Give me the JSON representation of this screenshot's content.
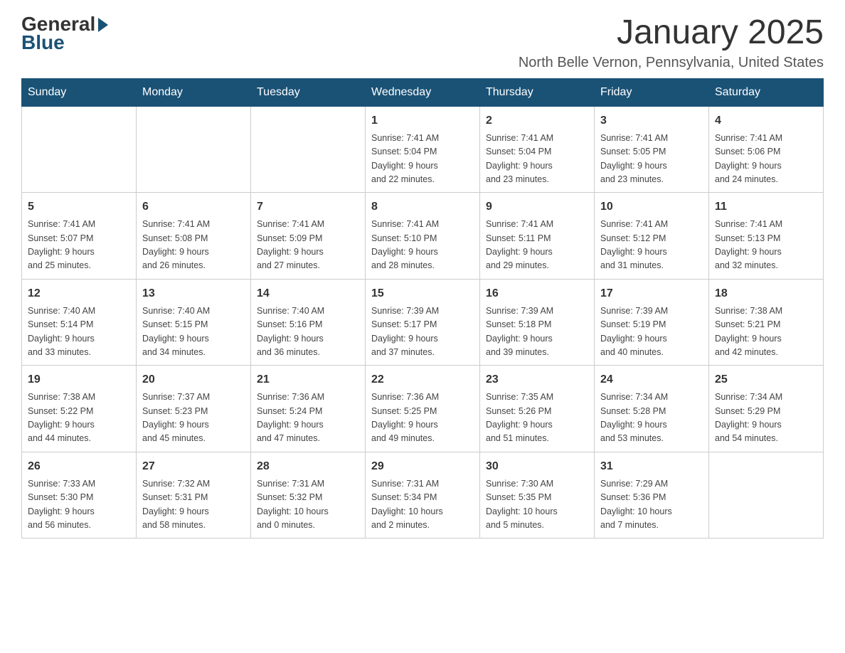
{
  "logo": {
    "general": "General",
    "blue": "Blue"
  },
  "title": "January 2025",
  "subtitle": "North Belle Vernon, Pennsylvania, United States",
  "days_of_week": [
    "Sunday",
    "Monday",
    "Tuesday",
    "Wednesday",
    "Thursday",
    "Friday",
    "Saturday"
  ],
  "weeks": [
    [
      {
        "day": "",
        "info": ""
      },
      {
        "day": "",
        "info": ""
      },
      {
        "day": "",
        "info": ""
      },
      {
        "day": "1",
        "info": "Sunrise: 7:41 AM\nSunset: 5:04 PM\nDaylight: 9 hours\nand 22 minutes."
      },
      {
        "day": "2",
        "info": "Sunrise: 7:41 AM\nSunset: 5:04 PM\nDaylight: 9 hours\nand 23 minutes."
      },
      {
        "day": "3",
        "info": "Sunrise: 7:41 AM\nSunset: 5:05 PM\nDaylight: 9 hours\nand 23 minutes."
      },
      {
        "day": "4",
        "info": "Sunrise: 7:41 AM\nSunset: 5:06 PM\nDaylight: 9 hours\nand 24 minutes."
      }
    ],
    [
      {
        "day": "5",
        "info": "Sunrise: 7:41 AM\nSunset: 5:07 PM\nDaylight: 9 hours\nand 25 minutes."
      },
      {
        "day": "6",
        "info": "Sunrise: 7:41 AM\nSunset: 5:08 PM\nDaylight: 9 hours\nand 26 minutes."
      },
      {
        "day": "7",
        "info": "Sunrise: 7:41 AM\nSunset: 5:09 PM\nDaylight: 9 hours\nand 27 minutes."
      },
      {
        "day": "8",
        "info": "Sunrise: 7:41 AM\nSunset: 5:10 PM\nDaylight: 9 hours\nand 28 minutes."
      },
      {
        "day": "9",
        "info": "Sunrise: 7:41 AM\nSunset: 5:11 PM\nDaylight: 9 hours\nand 29 minutes."
      },
      {
        "day": "10",
        "info": "Sunrise: 7:41 AM\nSunset: 5:12 PM\nDaylight: 9 hours\nand 31 minutes."
      },
      {
        "day": "11",
        "info": "Sunrise: 7:41 AM\nSunset: 5:13 PM\nDaylight: 9 hours\nand 32 minutes."
      }
    ],
    [
      {
        "day": "12",
        "info": "Sunrise: 7:40 AM\nSunset: 5:14 PM\nDaylight: 9 hours\nand 33 minutes."
      },
      {
        "day": "13",
        "info": "Sunrise: 7:40 AM\nSunset: 5:15 PM\nDaylight: 9 hours\nand 34 minutes."
      },
      {
        "day": "14",
        "info": "Sunrise: 7:40 AM\nSunset: 5:16 PM\nDaylight: 9 hours\nand 36 minutes."
      },
      {
        "day": "15",
        "info": "Sunrise: 7:39 AM\nSunset: 5:17 PM\nDaylight: 9 hours\nand 37 minutes."
      },
      {
        "day": "16",
        "info": "Sunrise: 7:39 AM\nSunset: 5:18 PM\nDaylight: 9 hours\nand 39 minutes."
      },
      {
        "day": "17",
        "info": "Sunrise: 7:39 AM\nSunset: 5:19 PM\nDaylight: 9 hours\nand 40 minutes."
      },
      {
        "day": "18",
        "info": "Sunrise: 7:38 AM\nSunset: 5:21 PM\nDaylight: 9 hours\nand 42 minutes."
      }
    ],
    [
      {
        "day": "19",
        "info": "Sunrise: 7:38 AM\nSunset: 5:22 PM\nDaylight: 9 hours\nand 44 minutes."
      },
      {
        "day": "20",
        "info": "Sunrise: 7:37 AM\nSunset: 5:23 PM\nDaylight: 9 hours\nand 45 minutes."
      },
      {
        "day": "21",
        "info": "Sunrise: 7:36 AM\nSunset: 5:24 PM\nDaylight: 9 hours\nand 47 minutes."
      },
      {
        "day": "22",
        "info": "Sunrise: 7:36 AM\nSunset: 5:25 PM\nDaylight: 9 hours\nand 49 minutes."
      },
      {
        "day": "23",
        "info": "Sunrise: 7:35 AM\nSunset: 5:26 PM\nDaylight: 9 hours\nand 51 minutes."
      },
      {
        "day": "24",
        "info": "Sunrise: 7:34 AM\nSunset: 5:28 PM\nDaylight: 9 hours\nand 53 minutes."
      },
      {
        "day": "25",
        "info": "Sunrise: 7:34 AM\nSunset: 5:29 PM\nDaylight: 9 hours\nand 54 minutes."
      }
    ],
    [
      {
        "day": "26",
        "info": "Sunrise: 7:33 AM\nSunset: 5:30 PM\nDaylight: 9 hours\nand 56 minutes."
      },
      {
        "day": "27",
        "info": "Sunrise: 7:32 AM\nSunset: 5:31 PM\nDaylight: 9 hours\nand 58 minutes."
      },
      {
        "day": "28",
        "info": "Sunrise: 7:31 AM\nSunset: 5:32 PM\nDaylight: 10 hours\nand 0 minutes."
      },
      {
        "day": "29",
        "info": "Sunrise: 7:31 AM\nSunset: 5:34 PM\nDaylight: 10 hours\nand 2 minutes."
      },
      {
        "day": "30",
        "info": "Sunrise: 7:30 AM\nSunset: 5:35 PM\nDaylight: 10 hours\nand 5 minutes."
      },
      {
        "day": "31",
        "info": "Sunrise: 7:29 AM\nSunset: 5:36 PM\nDaylight: 10 hours\nand 7 minutes."
      },
      {
        "day": "",
        "info": ""
      }
    ]
  ]
}
